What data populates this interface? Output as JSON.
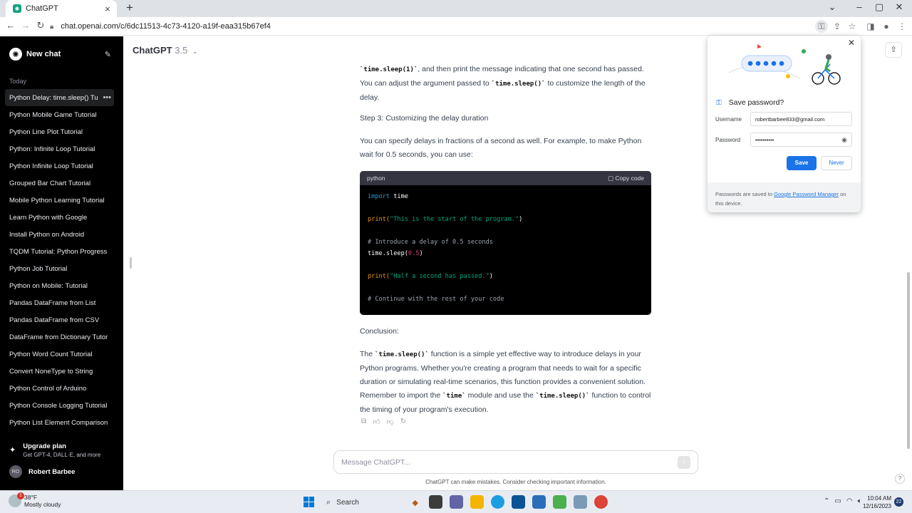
{
  "browser": {
    "tab_title": "ChatGPT",
    "url": "chat.openai.com/c/6dc11513-4c73-4120-a19f-eaa315b67ef4"
  },
  "sidebar": {
    "new_chat": "New chat",
    "section_label": "Today",
    "items": [
      "Python Delay: time.sleep() Tu",
      "Python Mobile Game Tutorial",
      "Python Line Plot Tutorial",
      "Python: Infinite Loop Tutorial",
      "Python Infinite Loop Tutorial",
      "Grouped Bar Chart Tutorial",
      "Mobile Python Learning Tutorial",
      "Learn Python with Google",
      "Install Python on Android",
      "TQDM Tutorial: Python Progress",
      "Python Job Tutorial",
      "Python on Mobile: Tutorial",
      "Pandas DataFrame from List",
      "Pandas DataFrame from CSV",
      "DataFrame from Dictionary Tutor",
      "Python Word Count Tutorial",
      "Convert NoneType to String",
      "Python Control of Arduino",
      "Python Console Logging Tutorial",
      "Python List Element Comparison"
    ],
    "upgrade_title": "Upgrade plan",
    "upgrade_sub": "Get GPT-4, DALL·E, and more",
    "user_initials": "RO",
    "user_name": "Robert Barbee"
  },
  "header": {
    "model_name": "ChatGPT",
    "model_version": "3.5"
  },
  "message": {
    "p1_a": "`time.sleep(1)`",
    "p1_b": ", and then print the message indicating that one second has passed. You can adjust the argument passed to ",
    "p1_c": "`time.sleep()`",
    "p1_d": " to customize the length of the delay.",
    "step3": "Step 3: Customizing the delay duration",
    "p2": "You can specify delays in fractions of a second as well. For example, to make Python wait for 0.5 seconds, you can use:",
    "code_lang": "python",
    "copy_label": "Copy code",
    "conclusion": "Conclusion:",
    "p3_a": "The ",
    "p3_b": "`time.sleep()`",
    "p3_c": " function is a simple yet effective way to introduce delays in your Python programs. Whether you're creating a program that needs to wait for a specific duration or simulating real-time scenarios, this function provides a convenient solution. Remember to import the ",
    "p3_d": "`time`",
    "p3_e": " module and use the ",
    "p3_f": "`time.sleep()`",
    "p3_g": " function to control the timing of your program's execution."
  },
  "code": {
    "l1_kw": "import",
    "l1_rest": " time",
    "l2_fn": "print(",
    "l2_str": "\"This is the start of the program.\"",
    "l2_end": ")",
    "l3_cm": "# Introduce a delay of 0.5 seconds",
    "l4_a": "time.sleep(",
    "l4_num": "0.5",
    "l4_end": ")",
    "l5_fn": "print(",
    "l5_str": "\"Half a second has passed.\"",
    "l5_end": ")",
    "l6_cm": "# Continue with the rest of your code"
  },
  "composer": {
    "placeholder": "Message ChatGPT...",
    "disclaimer": "ChatGPT can make mistakes. Consider checking important information."
  },
  "password_popup": {
    "title": "Save password?",
    "username_label": "Username",
    "username_value": "robertbarbee833@gmail.com",
    "password_label": "Password",
    "password_value": "••••••••••",
    "save_label": "Save",
    "never_label": "Never",
    "footer_a": "Passwords are saved to ",
    "footer_link": "Google Password Manager",
    "footer_b": " on this device."
  },
  "taskbar": {
    "temp": "38°F",
    "weather": "Mostly cloudy",
    "weather_badge": "1",
    "search": "Search",
    "time": "10:04 AM",
    "date": "12/16/2023",
    "notif_count": "22"
  },
  "colors": {
    "accent_blue": "#1a73e8",
    "sidebar_bg": "#000000",
    "code_bg": "#000000"
  }
}
